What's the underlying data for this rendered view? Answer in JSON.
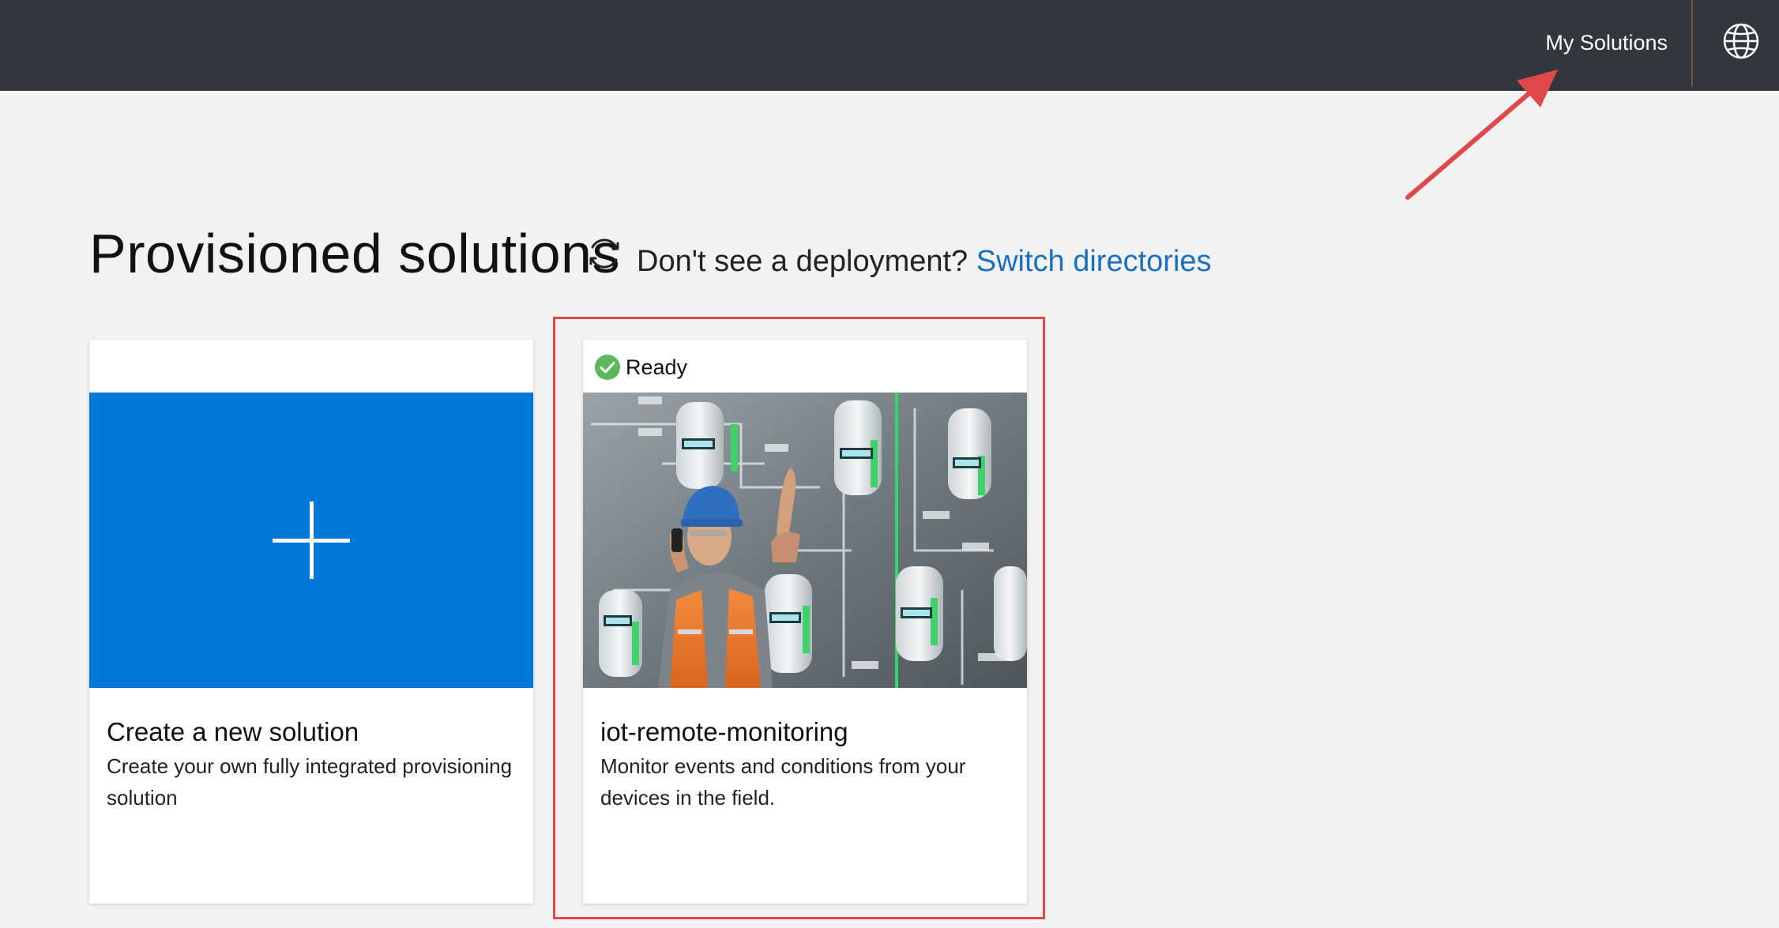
{
  "header": {
    "nav_link": "My Solutions",
    "globe_icon": "globe-icon"
  },
  "heading": {
    "title": "Provisioned solutions",
    "refresh_icon": "refresh-icon",
    "directory_prompt": "Don't see a deployment?",
    "directory_link": "Switch directories"
  },
  "cards": [
    {
      "title": "Create a new solution",
      "description": "Create your own fully integrated provisioning solution",
      "icon": "plus-icon",
      "media_color": "#0078d7"
    },
    {
      "status": "Ready",
      "status_icon": "check-circle-icon",
      "status_color": "#5cb85c",
      "title": "iot-remote-monitoring",
      "description": "Monitor events and conditions from your devices in the field.",
      "image": "industrial-worker-photo"
    }
  ],
  "annotation": {
    "highlight_color": "#e0484a"
  }
}
